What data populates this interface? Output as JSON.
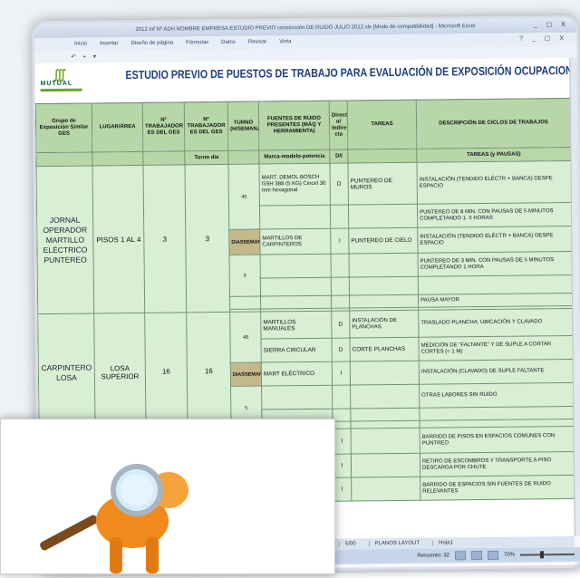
{
  "window": {
    "title": "2012 inf Nº ADH NOMBRE EMPRESA ESTUDIO PREVIO constrcción DE RUIDO JULIO 2012.xls [Modo de compatibilidad] - Microsoft Excel",
    "controls": "_ ▢ X"
  },
  "ribbon": {
    "tabs": [
      "Inicio",
      "Insertar",
      "Diseño de página",
      "Fórmulas",
      "Datos",
      "Revisar",
      "Vista"
    ],
    "controls": "? _ ▢ X"
  },
  "logo": {
    "name": "MUTUAL",
    "mark": "∭"
  },
  "sheet_title": "ESTUDIO PREVIO DE PUESTOS DE TRABAJO PARA EVALUACIÓN DE EXPOSICIÓN OCUPACIONAL A RUIDO",
  "headers": {
    "grupo": "Grupo de Exposición Similar GES",
    "lugar": "LUGAR/ÁREA",
    "ntrab1": "Nº TRABAJADOR ES DEL GES",
    "ntrab2": "Nº TRABAJADOR ES DEL GES",
    "turno": "TURNO (H/SEMANA)",
    "fuentes": "FUENTES DE RUIDO PRESENTES (MÁQ Y HERRAMIENTA)",
    "direct": "Direct o/ Indire cta",
    "tareas": "TAREAS",
    "desc": "DESCRIPCIÓN DE CICLOS DE TRABAJOS",
    "turno_dia": "Turno día",
    "marca": "Marca-modelo-potencia",
    "di": "D/I",
    "tareas_pausas": "TAREAS (y PAUSAS)"
  },
  "group1": {
    "ges": "JORNAL OPERADOR MARTILLO ELÉCTRICO PUNTEREO",
    "lugar": "PISOS 1 AL 4",
    "n1": "3",
    "n2": "3",
    "turno_a": "45",
    "diasem": "DIASSEMANA",
    "turno_b": "5",
    "fuente1": "MART. DEMOL BOSCH GSH 388 (5 KG) Cincel 30 mm hexagonal",
    "di1": "D",
    "tarea1": "PUNTEREO DE MUROS",
    "desc1": "INSTALACIÓN (TENDIDO ELÉCTR + BANCA) DESPE ESPACIO",
    "desc2": "PUNTEREO DE 8 MIN. CON PAUSAS DE 5 MINUTOS COMPLETANDO 1. 5 HORAS",
    "fuente2": "MARTILLOS DE CARPINTEROS",
    "di2": "I",
    "tarea2": "PUNTEREO DE CIELO",
    "desc3": "INSTALACIÓN (TENDIDO ELÉCTR + BANCA) DESPE ESPACIO",
    "desc4": "PUNTEREO DE 3 MIN. CON PAUSAS DE 5 MINUTOS COMPLETANDO 1 HORA",
    "desc5": "PAUSA MAYOR"
  },
  "group2": {
    "ges": "CARPINTERO LOSA",
    "lugar": "LOSA SUPERIOR",
    "n1": "16",
    "n2": "16",
    "turno_a": "48",
    "diasem": "DIASSEMANA",
    "turno_b": "5",
    "tarea1": "INSTALACIÓN DE PLANCHAS",
    "fuente1": "MARTILLOS MANUALES",
    "di1": "D",
    "desc1": "TRASLADO PLANCHA, UBICACIÓN Y CLAVADO",
    "fuente2": "SIERRA CIRCULAR",
    "di2": "D",
    "tarea2": "CORTE PLANCHAS",
    "desc2": "MEDICIÓN DE \"FALTANTE\" Y DE SUPLE A CORTAR CORTES (< 1 M)",
    "fuente3": "MART ELÉCTRICO",
    "di3": "I",
    "desc3": "INSTALACIÓN (CLAVADO) DE SUPLE FALTANTE",
    "desc4": "OTRAS LABORES SIN RUIDO"
  },
  "group3": {
    "di1": "I",
    "desc1": "BARRIDO DE PISOS EN ESPACIOS COMUNES CON PUNTREO",
    "di2": "I",
    "desc2": "RETIRO DE ESCOMBROS Y TRANSPORTE A PISO DESCARGA POR CHUTE",
    "di3": "I",
    "desc3": "BARRIDO DE ESPACIOS SIN FUENTES DE RUIDO RELEVANTES"
  },
  "tabs": [
    "5/00",
    "PLANOS LAYOUT",
    "Hoja1"
  ],
  "status": {
    "recuento": "Recuento: 32",
    "zoom": "70%"
  },
  "colors": {
    "header_green": "#b7d7a8",
    "body_green": "#d8efd4",
    "title_blue": "#1f3e78",
    "diasemana": "#c3b98a"
  }
}
